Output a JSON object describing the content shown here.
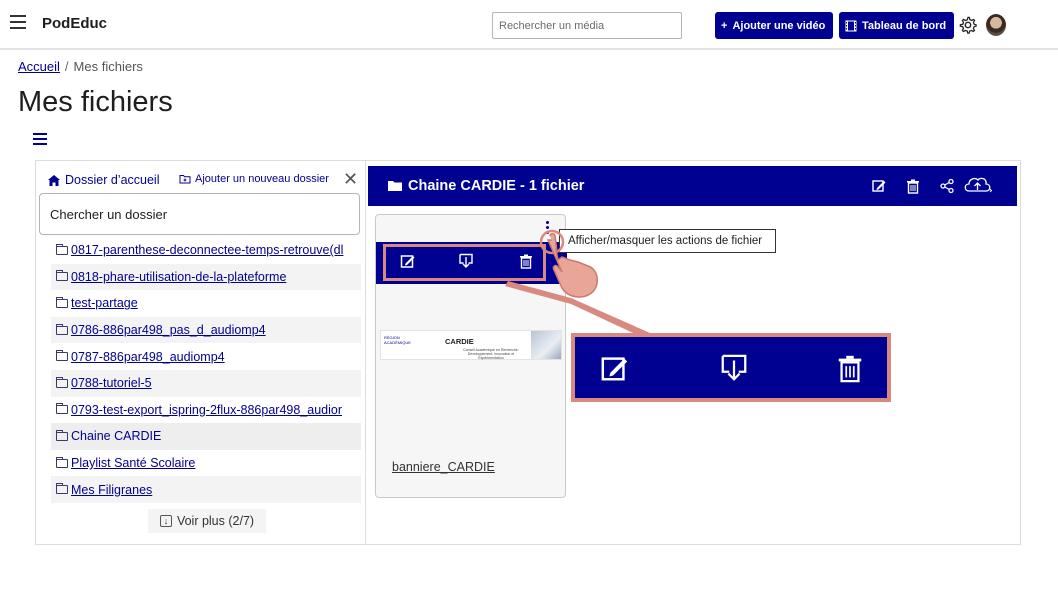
{
  "header": {
    "brand": "PodEduc",
    "search_placeholder": "Rechercher un média",
    "add_video_label": "Ajouter une vidéo",
    "dashboard_label": "Tableau de bord"
  },
  "breadcrumb": {
    "home": "Accueil",
    "separator": "/",
    "current": "Mes fichiers"
  },
  "page": {
    "title": "Mes fichiers"
  },
  "sidebar": {
    "home_folder": "Dossier d’accueil",
    "new_folder": "Ajouter un nouveau dossier",
    "search_placeholder": "Chercher un dossier",
    "folders": [
      {
        "label": "0817-parenthese-deconnectee-temps-retrouve(dl"
      },
      {
        "label": "0818-phare-utilisation-de-la-plateforme"
      },
      {
        "label": "test-partage"
      },
      {
        "label": "0786-886par498_pas_d_audiomp4"
      },
      {
        "label": "0787-886par498_audiomp4"
      },
      {
        "label": "0788-tutoriel-5"
      },
      {
        "label": "0793-test-export_ispring-2flux-886par498_audior"
      },
      {
        "label": "Chaine CARDIE"
      },
      {
        "label": "Playlist Santé Scolaire"
      },
      {
        "label": "Mes Filigranes"
      }
    ],
    "see_more": "Voir plus (2/7)"
  },
  "folder": {
    "title": "Chaine CARDIE - 1 fichier",
    "tooltip": "Afficher/masquer les actions de fichier"
  },
  "file_card": {
    "name": "banniere_CARDIE",
    "banner_title": "CARDIE",
    "banner_subtitle": "Conseil Académique en Recherche-Développement, Innovation et Expérimentation",
    "banner_mark": "RÉGION ACADÉMIQUE"
  },
  "colors": {
    "primary": "#000091",
    "highlight": "#d88a80"
  }
}
